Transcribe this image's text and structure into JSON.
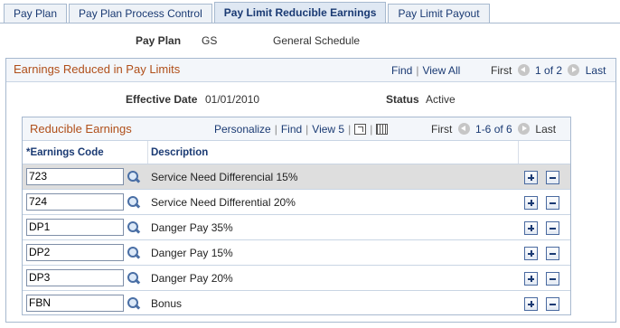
{
  "tabs": [
    {
      "label": "Pay Plan",
      "active": false
    },
    {
      "label": "Pay Plan Process Control",
      "active": false
    },
    {
      "label": "Pay Limit Reducible Earnings",
      "active": true
    },
    {
      "label": "Pay Limit Payout",
      "active": false
    }
  ],
  "header": {
    "pay_plan_label": "Pay Plan",
    "pay_plan_code": "GS",
    "pay_plan_desc": "General Schedule"
  },
  "outer": {
    "title": "Earnings Reduced in Pay Limits",
    "find": "Find",
    "view_all": "View All",
    "first": "First",
    "range": "1 of 2",
    "last": "Last",
    "effective_date_label": "Effective Date",
    "effective_date": "01/01/2010",
    "status_label": "Status",
    "status": "Active"
  },
  "grid": {
    "title": "Reducible Earnings",
    "personalize": "Personalize",
    "find": "Find",
    "view": "View 5",
    "first": "First",
    "range": "1-6 of 6",
    "last": "Last",
    "col_code": "*Earnings Code",
    "col_desc": "Description",
    "rows": [
      {
        "code": "723",
        "desc": "Service Need  Differencial 15%"
      },
      {
        "code": "724",
        "desc": "Service Need Differential 20%"
      },
      {
        "code": "DP1",
        "desc": "Danger Pay 35%"
      },
      {
        "code": "DP2",
        "desc": "Danger Pay 15%"
      },
      {
        "code": "DP3",
        "desc": "Danger Pay 20%"
      },
      {
        "code": "FBN",
        "desc": "Bonus"
      }
    ]
  }
}
